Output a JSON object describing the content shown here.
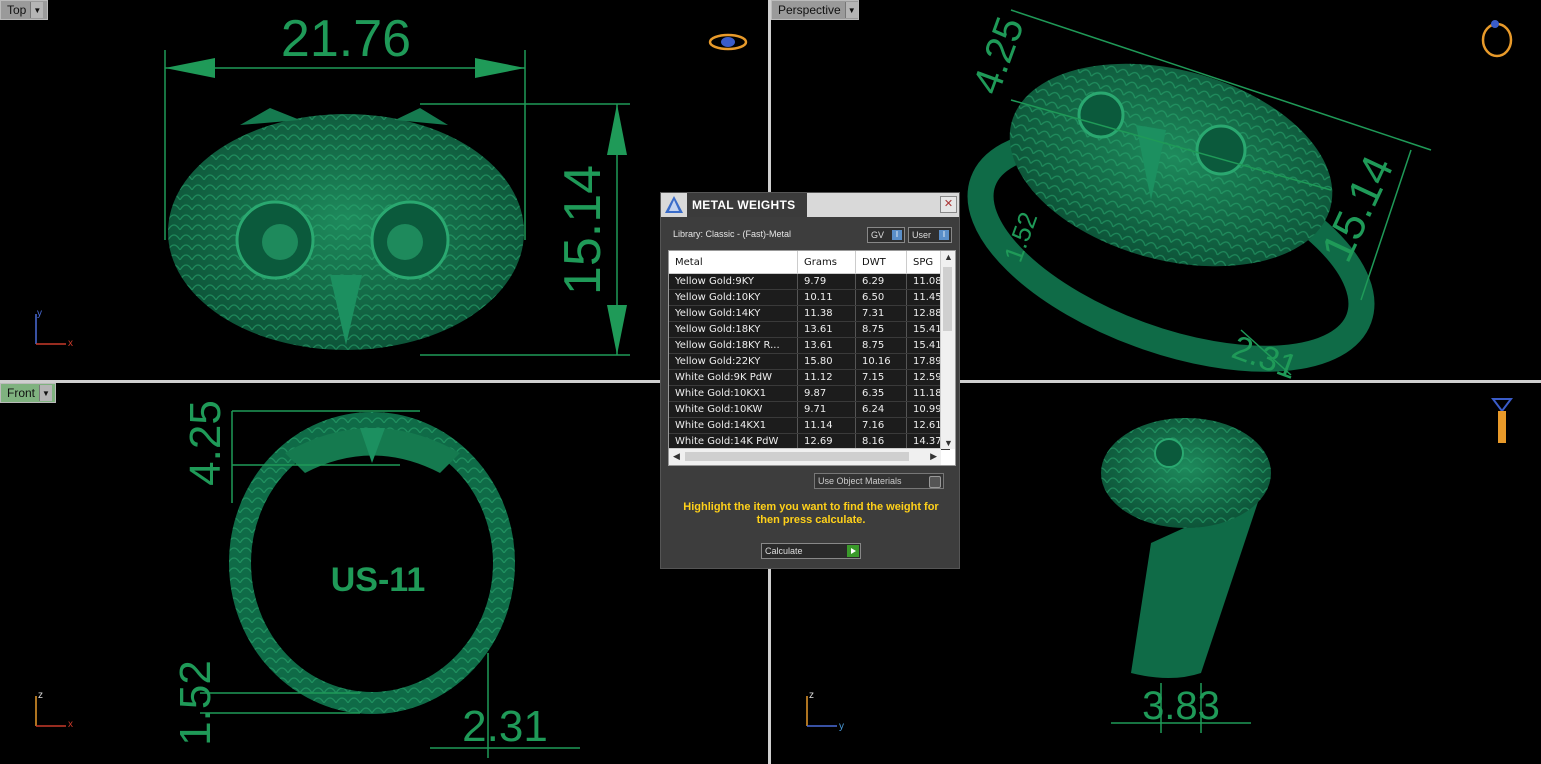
{
  "viewports": {
    "top": {
      "label": "Top",
      "dims": {
        "width": "21.76",
        "height": "15.14"
      },
      "axes": {
        "h": "x",
        "v": "y"
      }
    },
    "perspective": {
      "label": "Perspective",
      "dims": {
        "d1": "4.25",
        "d2": "15.14",
        "d3": "1.52",
        "d4": "2.31"
      }
    },
    "front": {
      "label": "Front",
      "dims": {
        "d1": "4.25",
        "d2": "1.52",
        "d3": "2.31"
      },
      "size_text": "US-11",
      "axes": {
        "h": "x",
        "v": "z"
      }
    },
    "right": {
      "dims": {
        "d1": "3.83"
      },
      "axes": {
        "h": "y",
        "v": "z"
      }
    }
  },
  "dialog": {
    "title": "METAL WEIGHTS",
    "close": "✕",
    "library": "Library: Classic - (Fast)-Metal",
    "gv_label": "GV",
    "user_label": "User",
    "columns": [
      "Metal",
      "Grams",
      "DWT",
      "SPG"
    ],
    "rows": [
      [
        "Yellow Gold:9KY",
        "9.79",
        "6.29",
        "11.08"
      ],
      [
        "Yellow Gold:10KY",
        "10.11",
        "6.50",
        "11.45"
      ],
      [
        "Yellow Gold:14KY",
        "11.38",
        "7.31",
        "12.88"
      ],
      [
        "Yellow Gold:18KY",
        "13.61",
        "8.75",
        "15.41"
      ],
      [
        "Yellow Gold:18KY R...",
        "13.61",
        "8.75",
        "15.41"
      ],
      [
        "Yellow Gold:22KY",
        "15.80",
        "10.16",
        "17.89"
      ],
      [
        "White Gold:9K PdW",
        "11.12",
        "7.15",
        "12.59"
      ],
      [
        "White Gold:10KX1",
        "9.87",
        "6.35",
        "11.18"
      ],
      [
        "White Gold:10KW",
        "9.71",
        "6.24",
        "10.99"
      ],
      [
        "White Gold:14KX1",
        "11.14",
        "7.16",
        "12.61"
      ],
      [
        "White Gold:14K PdW",
        "12.69",
        "8.16",
        "14.37"
      ]
    ],
    "use_object_materials": "Use Object Materials",
    "hint": "Highlight the item you want to find the weight for then press calculate.",
    "calculate": "Calculate"
  },
  "colors": {
    "model": "#0f6b47",
    "dimension": "#1f9a58",
    "hint": "#ffd11a"
  }
}
